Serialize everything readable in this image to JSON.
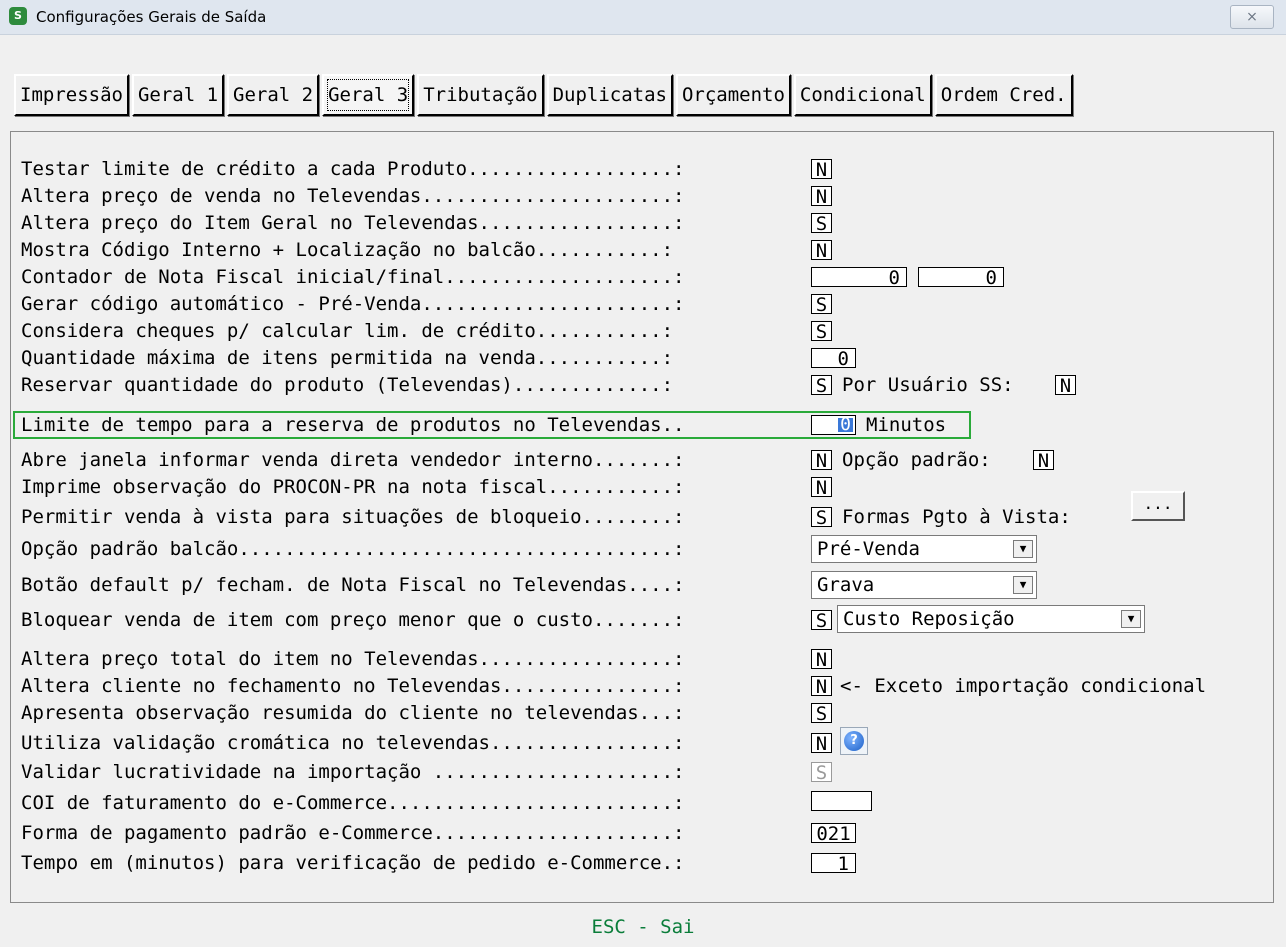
{
  "window": {
    "title": "Configurações Gerais de Saída",
    "close_label": "⨯"
  },
  "tabs": [
    {
      "label": "Impressão"
    },
    {
      "label": "Geral 1"
    },
    {
      "label": "Geral 2"
    },
    {
      "label": "Geral 3",
      "active": true
    },
    {
      "label": "Tributação"
    },
    {
      "label": "Duplicatas"
    },
    {
      "label": "Orçamento"
    },
    {
      "label": "Condicional"
    },
    {
      "label": "Ordem Cred."
    }
  ],
  "rows": [
    {
      "label": "Testar limite de crédito a cada Produto..................:",
      "value": "N"
    },
    {
      "label": "Altera preço de venda no Televendas......................:",
      "value": "N"
    },
    {
      "label": "Altera preço do Item Geral no Televendas.................:",
      "value": "S"
    },
    {
      "label": "Mostra Código Interno + Localização no balcão...........:",
      "value": "N"
    },
    {
      "label": "Contador de Nota Fiscal inicial/final....................:",
      "value": "0",
      "value2": "0"
    },
    {
      "label": "Gerar código automático - Pré-Venda......................:",
      "value": "S"
    },
    {
      "label": "Considera cheques p/ calcular lim. de crédito...........:",
      "value": "S"
    },
    {
      "label": "Quantidade máxima de itens permitida na venda...........:",
      "value": "0"
    },
    {
      "label": "Reservar quantidade do produto (Televendas).............:",
      "value": "S",
      "extra_label": "Por Usuário SS:",
      "extra_value": "N"
    },
    {
      "label": "Limite de tempo para a reserva de produtos no Televendas..",
      "value": "0",
      "extra_label": "Minutos"
    },
    {
      "label": "Abre janela informar venda direta vendedor interno.......:",
      "value": "N",
      "extra_label": "Opção padrão:",
      "extra_value": "N"
    },
    {
      "label": "Imprime observação do PROCON-PR na nota fiscal...........:",
      "value": "N"
    },
    {
      "label": "Permitir venda à vista para situações de bloqueio........:",
      "value": "S",
      "extra_label": "Formas Pgto à Vista:",
      "button_label": "..."
    },
    {
      "label": "Opção padrão balcão......................................:",
      "select": "Pré-Venda"
    },
    {
      "label": "Botão default p/ fecham. de Nota Fiscal no Televendas....:",
      "select": "Grava"
    },
    {
      "label": "Bloquear venda de item com preço menor que o custo.......:",
      "value": "S",
      "select": "Custo Reposição"
    },
    {
      "label": "Altera preço total do item no Televendas.................:",
      "value": "N"
    },
    {
      "label": "Altera cliente no fechamento no Televendas...............:",
      "value": "N",
      "extra_label": "<- Exceto importação condicional"
    },
    {
      "label": "Apresenta observação resumida do cliente no televendas...:",
      "value": "S"
    },
    {
      "label": "Utiliza validação cromática no televendas................:",
      "value": "N"
    },
    {
      "label": "Validar lucratividade na importação .....................:",
      "value": "S"
    },
    {
      "label": "COI de faturamento do e-Commerce.........................:",
      "value": ""
    },
    {
      "label": "Forma de pagamento padrão e-Commerce.....................:",
      "value": "021"
    },
    {
      "label": "Tempo em (minutos) para verificação de pedido e-Commerce.:",
      "value": "1"
    }
  ],
  "footer": {
    "text": "ESC - Sai"
  }
}
